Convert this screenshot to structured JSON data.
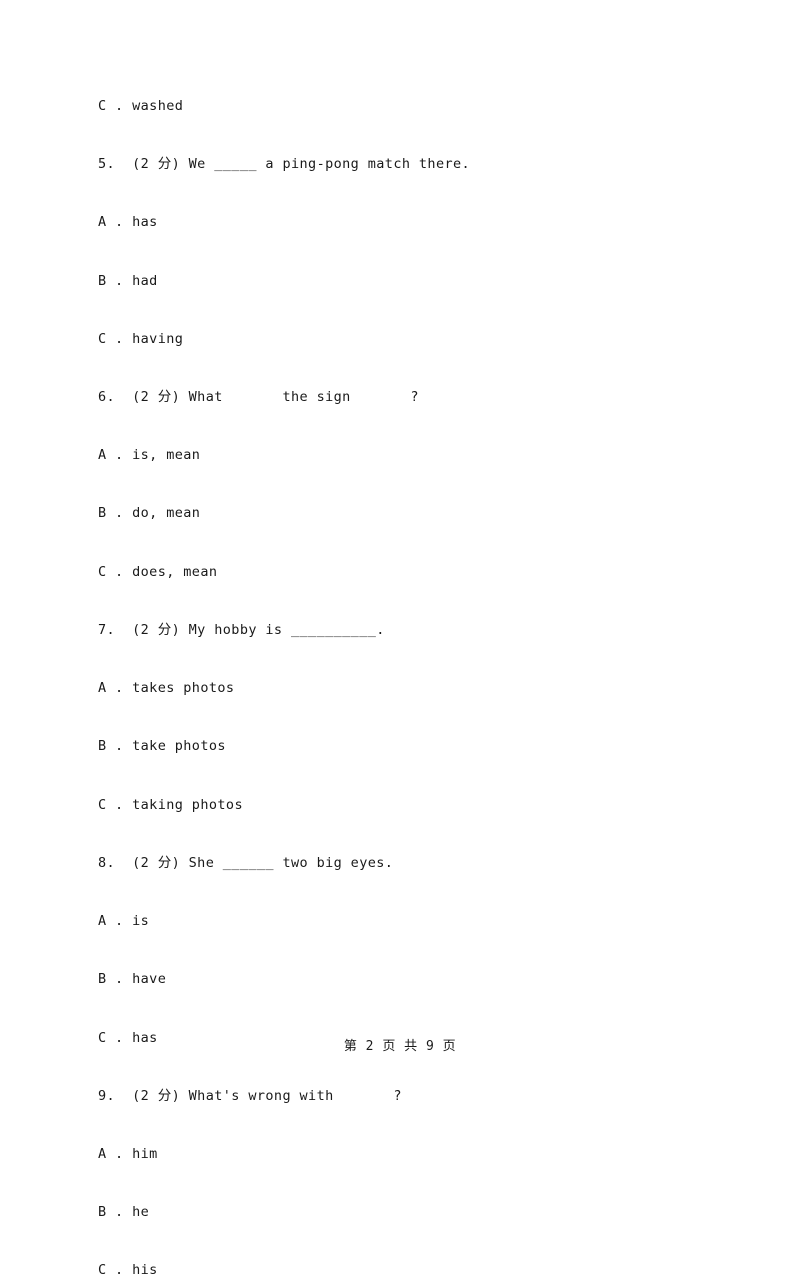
{
  "document": {
    "footer": "第 2 页 共 9 页",
    "lines": [
      {
        "text": "C . washed",
        "type": "option"
      },
      {
        "text": "5.  (2 分) We _____ a ping-pong match there.",
        "type": "question"
      },
      {
        "text": "A . has",
        "type": "option"
      },
      {
        "text": "B . had",
        "type": "option"
      },
      {
        "text": "C . having",
        "type": "option"
      },
      {
        "text": "6.  (2 分) What       the sign       ?",
        "type": "question"
      },
      {
        "text": "A . is, mean",
        "type": "option"
      },
      {
        "text": "B . do, mean",
        "type": "option"
      },
      {
        "text": "C . does, mean",
        "type": "option"
      },
      {
        "text": "7.  (2 分) My hobby is __________.",
        "type": "question"
      },
      {
        "text": "A . takes photos",
        "type": "option"
      },
      {
        "text": "B . take photos",
        "type": "option"
      },
      {
        "text": "C . taking photos",
        "type": "option"
      },
      {
        "text": "8.  (2 分) She ______ two big eyes.",
        "type": "question"
      },
      {
        "text": "A . is",
        "type": "option"
      },
      {
        "text": "B . have",
        "type": "option"
      },
      {
        "text": "C . has",
        "type": "option"
      },
      {
        "text": "9.  (2 分) What's wrong with       ?",
        "type": "question"
      },
      {
        "text": "A . him",
        "type": "option"
      },
      {
        "text": "B . he",
        "type": "option"
      },
      {
        "text": "C . his",
        "type": "option"
      }
    ]
  }
}
